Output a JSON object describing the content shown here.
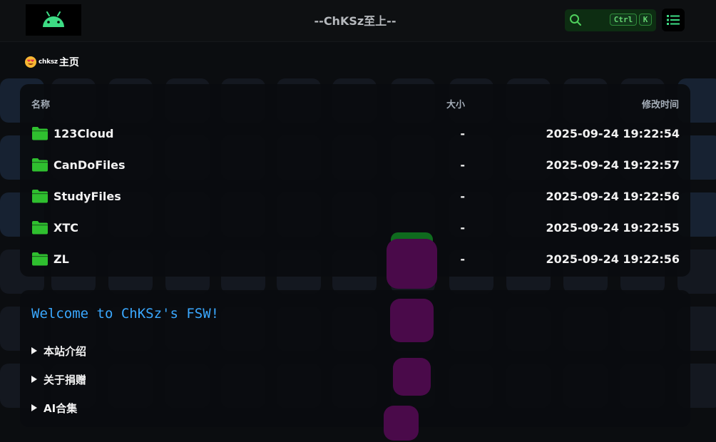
{
  "header": {
    "title": "--ChKSz至上--",
    "logo_icon": "android-icon",
    "search": {
      "shortcut_ctrl": "Ctrl",
      "shortcut_key": "K"
    },
    "accent": "#3ddc84"
  },
  "breadcrumb": {
    "user": "chksz",
    "home_label": "主页"
  },
  "file_table": {
    "columns": {
      "name": "名称",
      "size": "大小",
      "modified": "修改时间"
    },
    "rows": [
      {
        "name": "123Cloud",
        "size": "-",
        "modified": "2025-09-24 19:22:54"
      },
      {
        "name": "CanDoFiles",
        "size": "-",
        "modified": "2025-09-24 19:22:57"
      },
      {
        "name": "StudyFiles",
        "size": "-",
        "modified": "2025-09-24 19:22:56"
      },
      {
        "name": "XTC",
        "size": "-",
        "modified": "2025-09-24 19:22:55"
      },
      {
        "name": "ZL",
        "size": "-",
        "modified": "2025-09-24 19:22:56"
      }
    ],
    "folder_color": "#2fbf2f"
  },
  "readme": {
    "welcome": "Welcome to ChKSz's FSW!",
    "sections": [
      "本站介绍",
      "关于捐赠",
      "AI合集"
    ],
    "welcome_color": "#3aa8ff"
  },
  "colors": {
    "blob": "#4a0a4a",
    "blob_green": "#0f6b1e"
  }
}
